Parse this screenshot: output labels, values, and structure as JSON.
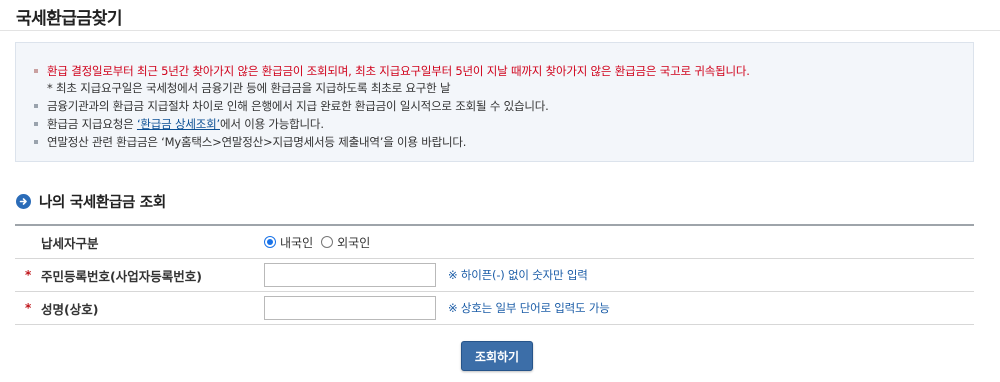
{
  "page": {
    "title": "국세환급금찾기"
  },
  "notice": {
    "items": [
      {
        "text": "환급 결정일로부터 최근 5년간 찾아가지 않은 환급금이 조회되며, 최초 지급요구일부터 5년이 지날 때까지 찾아가지 않은 환급금은 국고로 귀속됩니다.",
        "style": "red"
      },
      {
        "text": "* 최초 지급요구일은 국세청에서 금융기관 등에 환급금을 지급하도록 최초로 요구한 날",
        "style": "sub"
      },
      {
        "text": "금융기관과의 환급금 지급절차 차이로 인해 은행에서 지급 완료한 환급금이 일시적으로 조회될 수 있습니다.",
        "style": "normal"
      },
      {
        "prefix": "환급금 지급요청은 ",
        "link": "‘환급금 상세조회’",
        "suffix": "에서 이용 가능합니다.",
        "style": "normal"
      },
      {
        "text": "연말정산 관련 환급금은 ‘My홈택스>연말정산>지급명세서등 제출내역’을 이용 바랍니다.",
        "style": "normal"
      }
    ]
  },
  "section": {
    "title": "나의 국세환급금 조회",
    "icon": "arrow-circle-icon"
  },
  "form": {
    "taxpayer_type": {
      "label": "납세자구분",
      "options": [
        {
          "label": "내국인",
          "checked": true
        },
        {
          "label": "외국인",
          "checked": false
        }
      ]
    },
    "id_number": {
      "required_mark": "*",
      "label": "주민등록번호(사업자등록번호)",
      "value": "",
      "hint": "※ 하이픈(-) 없이 숫자만 입력"
    },
    "name": {
      "required_mark": "*",
      "label": "성명(상호)",
      "value": "",
      "hint": "※ 상호는 일부 단어로 입력도 가능"
    }
  },
  "actions": {
    "search_label": "조회하기"
  },
  "colors": {
    "accent": "#3c6ea8",
    "warning": "#d0021b",
    "hint": "#1d5ea8"
  }
}
